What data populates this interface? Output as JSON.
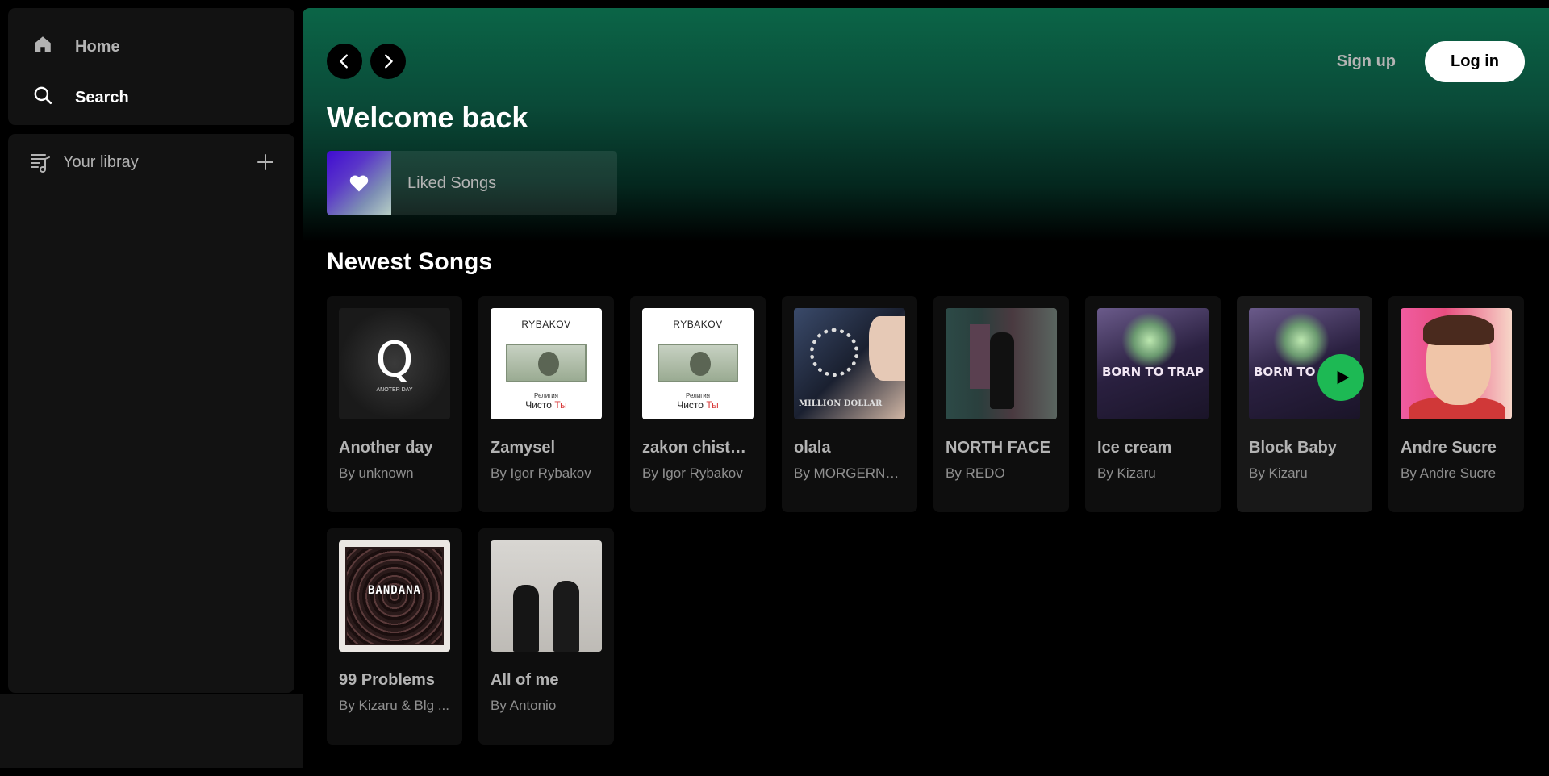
{
  "sidebar": {
    "nav": {
      "home_label": "Home",
      "search_label": "Search"
    },
    "library": {
      "title": "Your libray"
    }
  },
  "topbar": {
    "signup_label": "Sign up",
    "login_label": "Log in"
  },
  "main": {
    "welcome": "Welcome back",
    "liked_songs_label": "Liked Songs",
    "section_title": "Newest Songs"
  },
  "songs": [
    {
      "title": "Another day",
      "artist": "By unknown",
      "art_caption": "ANOTER DAY"
    },
    {
      "title": "Zamysel",
      "artist": "By Igor Rybakov",
      "art_brand": "RYBAKOV",
      "art_rel": "Религия",
      "art_chisto": "Чисто",
      "art_ty": "Ты"
    },
    {
      "title": "zakon chisto ti",
      "artist": "By Igor Rybakov",
      "art_brand": "RYBAKOV",
      "art_rel": "Религия",
      "art_chisto": "Чисто",
      "art_ty": "Ты"
    },
    {
      "title": "olala",
      "artist": "By MORGERNS...",
      "art_text": "MILLION DOLLAR"
    },
    {
      "title": "NORTH FACE",
      "artist": "By REDO"
    },
    {
      "title": "Ice cream",
      "artist": "By Kizaru",
      "art_text": "BORN TO TRAP"
    },
    {
      "title": "Block Baby",
      "artist": "By Kizaru",
      "art_text": "BORN TO TRAP"
    },
    {
      "title": "Andre Sucre",
      "artist": "By Andre Sucre"
    },
    {
      "title": "99 Problems",
      "artist": "By Kizaru & Blg ...",
      "art_text": "BANDANA"
    },
    {
      "title": "All of me",
      "artist": "By Antonio"
    }
  ],
  "colors": {
    "accent_green": "#1db954",
    "header_gradient_top": "#0b6547",
    "panel_bg": "#121212"
  },
  "icons": {
    "home": "home-icon",
    "search": "search-icon",
    "library": "library-icon",
    "plus": "plus-icon",
    "back": "chevron-left-icon",
    "forward": "chevron-right-icon",
    "heart": "heart-icon",
    "play": "play-icon"
  }
}
